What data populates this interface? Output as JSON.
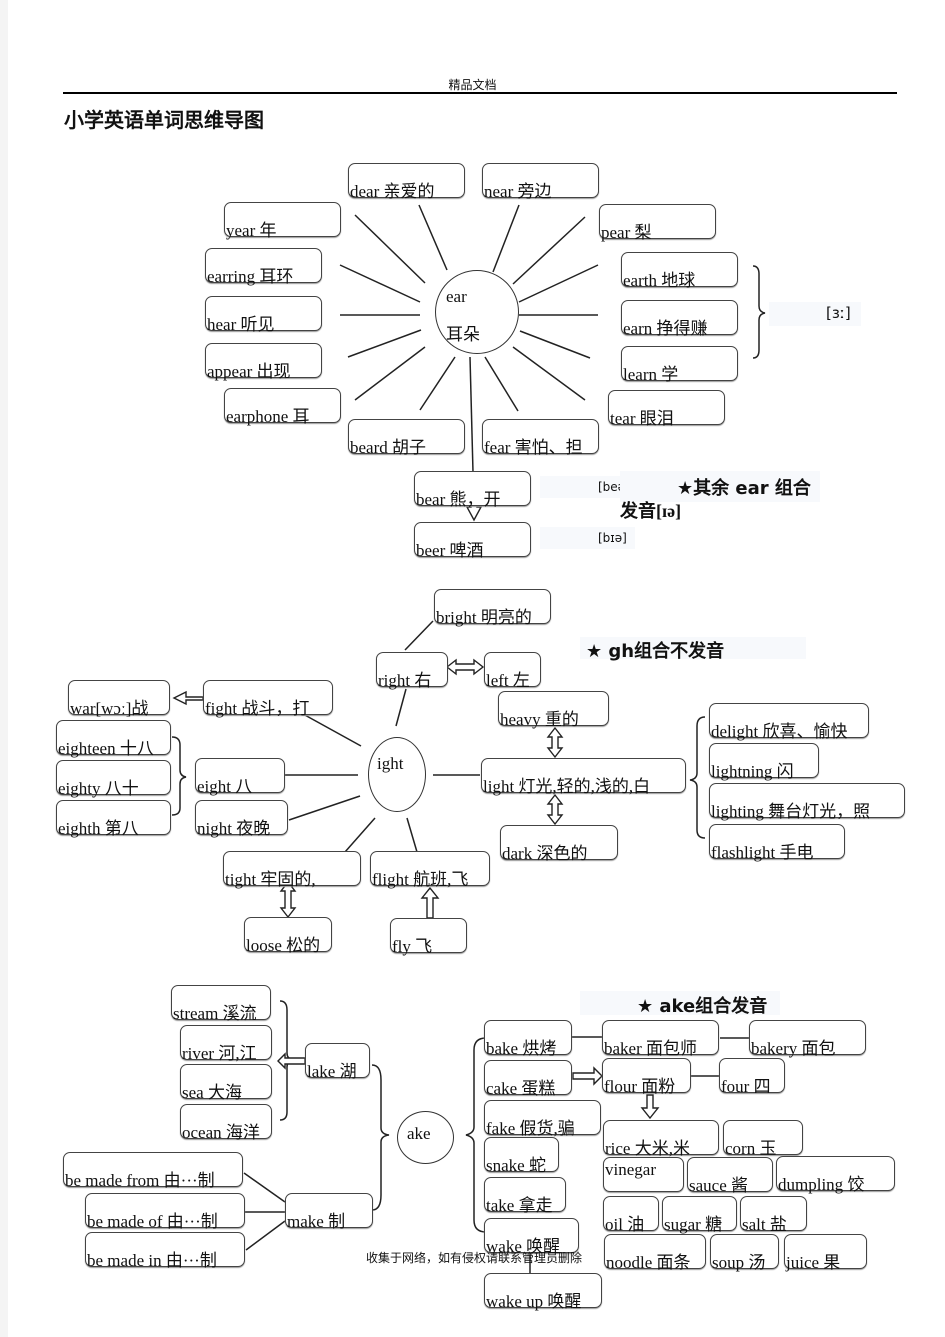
{
  "header": {
    "watermark": "精品文档",
    "title": "小学英语单词思维导图"
  },
  "footer": {
    "text": "收集于网络，如有侵权请联系管理员删除"
  },
  "ear_map": {
    "center": {
      "word": "ear",
      "meaning": "耳朵"
    },
    "nodes": {
      "dear": "dear 亲爱的",
      "near": "near 旁边",
      "year": "year 年",
      "pear": "pear 梨",
      "earring": "earring 耳环",
      "earth": "earth 地球",
      "hear": "hear 听见",
      "earn": "earn 挣得赚",
      "appear": "appear 出现",
      "learn": "learn 学",
      "earphone": "earphone 耳",
      "tear": "tear 眼泪",
      "beard": "beard 胡子",
      "fear": "fear 害怕、担",
      "bear": "bear 熊，开",
      "beer": "beer 啤酒"
    },
    "phonetic_er": "[ɜː]",
    "phonetic_bear": "[beə]",
    "phonetic_beer": "[bɪə]",
    "note_line1": "★其余 ear 组合",
    "note_line2": "发音[ɪə]"
  },
  "ight_map": {
    "center": "ight",
    "note": "★ gh组合不发音",
    "nodes": {
      "bright": "bright 明亮的",
      "right": "right 右",
      "left": "left 左",
      "war": "war[wɔː]战",
      "fight": "fight 战斗，打",
      "heavy": "heavy 重的",
      "eighteen": "eighteen 十八",
      "eighty": "eighty 八十",
      "eighth": "eighth 第八",
      "eight": "eight 八",
      "night": "night 夜晚",
      "light": "light 灯光,轻的,浅的,白",
      "dark": "dark 深色的",
      "tight": "tight 牢固的,",
      "loose": "loose 松的",
      "flight": "flight 航班,飞",
      "fly": "fly 飞",
      "delight": "delight 欣喜、愉快",
      "lightning": "lightning 闪",
      "lighting": "lighting 舞台灯光，照",
      "flashlight": "flashlight 手电"
    }
  },
  "ake_map": {
    "center": "ake",
    "note": "★ ake组合发音",
    "nodes": {
      "stream": "stream 溪流",
      "river": "river 河,江",
      "sea": "sea 大海",
      "ocean": "ocean 海洋",
      "lake": "lake 湖",
      "made_from": "be made from 由···制",
      "made_of": "be made of 由···制",
      "made_in": "be made in 由···制",
      "make": "make 制",
      "bake": "bake 烘烤",
      "cake": "cake 蛋糕",
      "fake": "fake 假货,骗",
      "snake": "snake 蛇",
      "take": "take 拿走",
      "wake": "wake 唤醒",
      "wake_up": "wake up 唤醒",
      "baker": "baker 面包师",
      "bakery": "bakery 面包",
      "flour": "flour 面粉",
      "four": "four 四",
      "rice": "rice 大米,米",
      "corn": "corn 玉",
      "vinegar": "vinegar",
      "sauce": "sauce 酱",
      "dumpling": "dumpling 饺",
      "oil": "oil 油",
      "sugar": "sugar 糖",
      "salt": "salt 盐",
      "noodle": "noodle 面条",
      "soup": "soup 汤",
      "juice": "juice 果"
    }
  }
}
